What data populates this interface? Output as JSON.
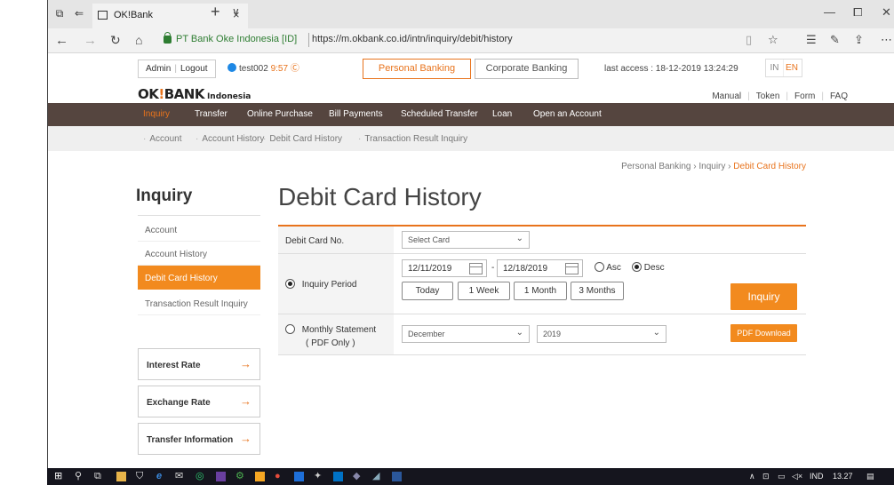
{
  "browser": {
    "tab_title": "OK!Bank",
    "tab_close": "×",
    "new_tab": "+",
    "tab_dropdown": "∨",
    "cert_label": "PT Bank Oke Indonesia [ID]",
    "url": "https://m.okbank.co.id/intn/inquiry/debit/history"
  },
  "header": {
    "admin_label": "Admin",
    "logout_label": "Logout",
    "username": "test002",
    "session_time": "9:57",
    "personal_banking": "Personal Banking",
    "corporate_banking": "Corporate Banking",
    "last_access": "last access : 18-12-2019 13:24:29",
    "lang_in": "IN",
    "lang_en": "EN",
    "logo_main": "OK",
    "logo_bang": "!",
    "logo_bank": "BANK",
    "logo_sub": "Indonesia",
    "links": [
      "Manual",
      "Token",
      "Form",
      "FAQ"
    ]
  },
  "gnb": [
    "Inquiry",
    "Transfer",
    "Online Purchase",
    "Bill Payments",
    "Scheduled Transfer",
    "Loan",
    "Open an Account"
  ],
  "lnb": [
    "Account",
    "Account History",
    "Debit Card History",
    "Transaction Result Inquiry"
  ],
  "breadcrumb": {
    "path": [
      "Personal Banking",
      "Inquiry"
    ],
    "current": "Debit Card History",
    "sep": "›"
  },
  "sidebar": {
    "title": "Inquiry",
    "items": [
      "Account",
      "Account History",
      "Debit Card History",
      "Transaction Result Inquiry"
    ],
    "boxes": [
      "Interest Rate",
      "Exchange Rate",
      "Transfer Information"
    ]
  },
  "main": {
    "title": "Debit Card History",
    "card_label": "Debit Card No.",
    "card_select": "Select Card",
    "period_label": "Inquiry Period",
    "date_from": "12/11/2019",
    "date_sep": "-",
    "date_to": "12/18/2019",
    "asc": "Asc",
    "desc": "Desc",
    "quick": [
      "Today",
      "1 Week",
      "1 Month",
      "3 Months"
    ],
    "inquiry_button": "Inquiry",
    "monthly_label": "Monthly Statement",
    "monthly_sub": "( PDF Only )",
    "month_value": "December",
    "year_value": "2019",
    "pdf_button": "PDF Download"
  },
  "taskbar": {
    "lang": "IND",
    "time": "13.27"
  },
  "colors": {
    "accent": "#f28a1e",
    "gnb_bg": "#55453f"
  }
}
